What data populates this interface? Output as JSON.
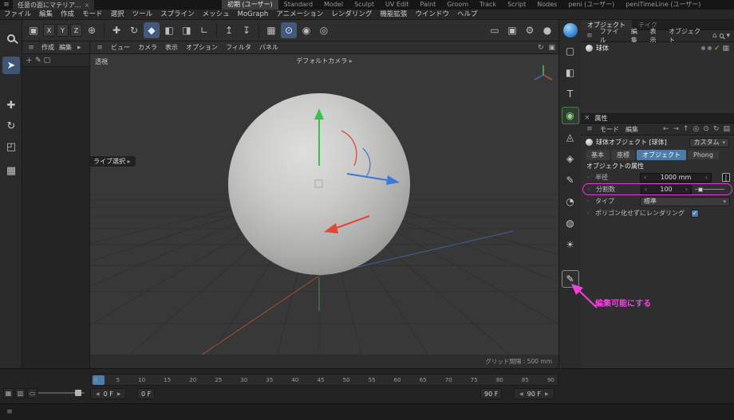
{
  "ui": {
    "hamburger": "≡",
    "spin_left": "‹",
    "spin_right": "›",
    "dropdown_arrow": "▾",
    "chevron": "▸",
    "play_left": "◀",
    "play_right": "▶",
    "cursor": "|"
  },
  "titlebar": {
    "doc_tab": "任意の面にマテリア...",
    "doc_tab_close": "×",
    "layout_tabs": [
      {
        "label": "初期 (ユーザー)",
        "active": true
      },
      {
        "label": "Standard"
      },
      {
        "label": "Model"
      },
      {
        "label": "Sculpt"
      },
      {
        "label": "UV Edit"
      },
      {
        "label": "Paint"
      },
      {
        "label": "Groom"
      },
      {
        "label": "Track"
      },
      {
        "label": "Script"
      },
      {
        "label": "Nodes"
      },
      {
        "label": "peni (ユーザー)"
      },
      {
        "label": "peniTimeLine (ユーザー)"
      }
    ]
  },
  "menubar": [
    {
      "label": "ファイル"
    },
    {
      "label": "編集"
    },
    {
      "label": "作成"
    },
    {
      "label": "モード"
    },
    {
      "label": "選択"
    },
    {
      "label": "ツール"
    },
    {
      "label": "スプライン"
    },
    {
      "label": "メッシュ"
    },
    {
      "label": "MoGraph"
    },
    {
      "label": "アニメーション"
    },
    {
      "label": "レンダリング"
    },
    {
      "label": "機能拡張"
    },
    {
      "label": "ウインドウ"
    },
    {
      "label": "ヘルプ"
    }
  ],
  "toolbar": {
    "first_icon": {
      "glyph": "▣"
    },
    "axis_buttons": [
      {
        "label": "X"
      },
      {
        "label": "Y"
      },
      {
        "label": "Z"
      }
    ],
    "coord_glyph": "⊕",
    "mid_icons": [
      {
        "glyph": "✚",
        "name": "move-gizmo-icon"
      },
      {
        "glyph": "↻",
        "name": "rotate-gizmo-icon"
      },
      {
        "glyph": "◆",
        "name": "modeling-settings-icon",
        "active": true
      },
      {
        "glyph": "◧",
        "name": "workplane-icon"
      },
      {
        "glyph": "◨",
        "name": "workplane-lock-icon"
      },
      {
        "glyph": "∟",
        "name": "axis-modify-icon"
      }
    ],
    "arrow_icons": [
      {
        "glyph": "↥",
        "name": "move-up-icon"
      },
      {
        "glyph": "↧",
        "name": "move-down-icon"
      }
    ],
    "snap_icons": [
      {
        "glyph": "▦",
        "name": "grid-snap-icon"
      },
      {
        "glyph": "⊙",
        "name": "snap-enable-icon",
        "active": true
      },
      {
        "glyph": "◉",
        "name": "quantize-icon"
      },
      {
        "glyph": "◎",
        "name": "snap-settings-icon"
      }
    ],
    "render_icons": [
      {
        "glyph": "▭",
        "name": "render-view-icon"
      },
      {
        "glyph": "▣",
        "name": "render-picture-viewer-icon"
      },
      {
        "glyph": "⚙",
        "name": "render-settings-icon"
      },
      {
        "glyph": "●",
        "name": "material-sphere-icon"
      }
    ]
  },
  "left_tools": {
    "select_glyph": "➤",
    "move_glyph": "✚",
    "rotate_glyph": "↻",
    "scale_glyph": "◰",
    "extra_glyph": "▦"
  },
  "left_panel": {
    "menus": [
      {
        "label": "作成"
      },
      {
        "label": "編集"
      }
    ],
    "icons": [
      {
        "glyph": "＋",
        "name": "add-icon"
      },
      {
        "glyph": "✎",
        "name": "pen-icon"
      },
      {
        "glyph": "▢",
        "name": "shape-icon"
      }
    ]
  },
  "viewport": {
    "menus": [
      {
        "label": "ビュー"
      },
      {
        "label": "カメラ"
      },
      {
        "label": "表示"
      },
      {
        "label": "オプション"
      },
      {
        "label": "フィルタ"
      },
      {
        "label": "パネル"
      }
    ],
    "corner_icons": [
      {
        "glyph": "↻",
        "name": "viewport-sync-icon"
      },
      {
        "glyph": "▣",
        "name": "viewport-toggle-icon"
      }
    ],
    "view_label": "透視",
    "camera_label": "デフォルトカメラ",
    "tool_label": "ライブ選択",
    "grid_label": "グリッド間隔 : 500 mm"
  },
  "right_strip": {
    "icons": [
      {
        "glyph": "▢",
        "name": "rectangle-tool-icon"
      },
      {
        "glyph": "◧",
        "name": "cube-tool-icon"
      },
      {
        "glyph": "T",
        "name": "text-tool-icon"
      },
      {
        "glyph": "◉",
        "name": "sphere-tool-icon",
        "active": true
      },
      {
        "glyph": "◬",
        "name": "cone-tool-icon"
      },
      {
        "glyph": "◈",
        "name": "platonic-tool-icon"
      },
      {
        "glyph": "✎",
        "name": "spline-pen-icon"
      },
      {
        "glyph": "◔",
        "name": "arc-tool-icon"
      },
      {
        "glyph": "◍",
        "name": "globe-tool-icon"
      },
      {
        "glyph": "☀",
        "name": "light-tool-icon"
      },
      {
        "glyph": "✎",
        "name": "make-editable-icon"
      }
    ]
  },
  "object_manager": {
    "tab_active": "オブジェクト",
    "tab_inactive": "テイク",
    "menus": [
      {
        "label": "ファイル"
      },
      {
        "label": "編集"
      },
      {
        "label": "表示"
      },
      {
        "label": "オブジェクト"
      }
    ],
    "home_glyph": "⌂",
    "object_name": "球体",
    "check_glyph": "✓",
    "mesh_glyph": "▦"
  },
  "attribute_manager": {
    "close_glyph": "×",
    "title": "属性",
    "menus": [
      {
        "label": "モード"
      },
      {
        "label": "編集"
      }
    ],
    "nav_icons": [
      {
        "glyph": "←",
        "name": "history-back-icon"
      },
      {
        "glyph": "→",
        "name": "history-forward-icon"
      },
      {
        "glyph": "↑",
        "name": "parent-object-icon"
      },
      {
        "glyph": "◎",
        "name": "focus-icon"
      },
      {
        "glyph": "⊙",
        "name": "lock-icon"
      },
      {
        "glyph": "↻",
        "name": "refresh-icon"
      },
      {
        "glyph": "▤",
        "name": "copy-icon"
      }
    ],
    "object_title": "球体オブジェクト [球体]",
    "preset": "カスタム",
    "tabs": [
      {
        "label": "基本"
      },
      {
        "label": "座標"
      },
      {
        "label": "オブジェクト",
        "active": true
      },
      {
        "label": "Phong"
      }
    ],
    "section_title": "オブジェクトの属性",
    "marker": "◦",
    "radius_label": "半径",
    "radius_value": "1000 mm",
    "segments_label": "分割数",
    "segments_value": "100",
    "type_label": "タイプ",
    "type_value": "標準",
    "render_label": "ポリゴン化せずにレンダリング",
    "check_glyph": "✓"
  },
  "timeline": {
    "ticks": [
      "0",
      "5",
      "10",
      "15",
      "20",
      "25",
      "30",
      "35",
      "40",
      "45",
      "50",
      "55",
      "60",
      "65",
      "70",
      "75",
      "80",
      "85",
      "90"
    ],
    "current_frame": "0 F",
    "range_start": "0 F",
    "range_end": "90 F",
    "end_frame": "90 F"
  },
  "bottom_icons": [
    {
      "glyph": "▦",
      "name": "layout-grid-icon"
    },
    {
      "glyph": "▥",
      "name": "layout-rows-icon"
    },
    {
      "glyph": "▭",
      "name": "layout-single-icon"
    }
  ],
  "annotation": {
    "label": "編集可能にする"
  }
}
